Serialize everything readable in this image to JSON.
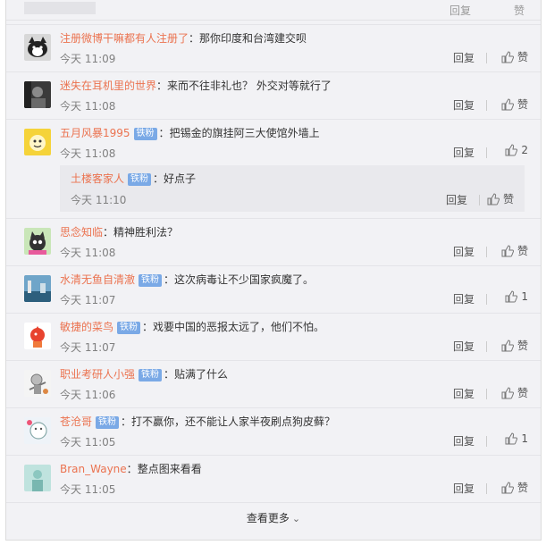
{
  "strip": {
    "reply": "回复",
    "like": "赞"
  },
  "comments": [
    {
      "user": "注册微博干嘛都有人注册了",
      "badge": "铁粉",
      "text": "那你印度和台湾建交呗",
      "time": "今天 11:09",
      "reply": "回复",
      "like": "赞"
    },
    {
      "user": "迷失在耳机里的世界",
      "badge": "",
      "text": "来而不往非礼也？ 外交对等就行了",
      "time": "今天 11:08",
      "reply": "回复",
      "like": "赞"
    },
    {
      "user": "五月风暴1995",
      "badge": "铁粉",
      "text": "把锡金的旗挂阿三大使馆外墙上",
      "time": "今天 11:08",
      "reply": "回复",
      "like": "2",
      "subreply": {
        "user": "土楼客家人",
        "badge": "铁粉",
        "text": "好点子",
        "time": "今天 11:10",
        "reply": "回复",
        "like": "赞"
      }
    },
    {
      "user": "思念知临",
      "badge": "",
      "text": "精神胜利法？",
      "time": "今天 11:08",
      "reply": "回复",
      "like": "赞"
    },
    {
      "user": "水清无鱼自清澈",
      "badge": "铁粉",
      "text": "这次病毒让不少国家疯魔了。",
      "time": "今天 11:07",
      "reply": "回复",
      "like": "1"
    },
    {
      "user": "敏捷的菜鸟",
      "badge": "铁粉",
      "text": "戏要中国的恶报太远了，他们不怕。",
      "time": "今天 11:07",
      "reply": "回复",
      "like": "赞"
    },
    {
      "user": "职业考研人小强",
      "badge": "铁粉",
      "text": "贴满了什么",
      "time": "今天 11:06",
      "reply": "回复",
      "like": "赞"
    },
    {
      "user": "苍沧哥",
      "badge": "铁粉",
      "text": "打不赢你，还不能让人家半夜刷点狗皮藓？",
      "time": "今天 11:05",
      "reply": "回复",
      "like": "1"
    },
    {
      "user": "Bran_Wayne",
      "badge": "",
      "text": "整点图来看看",
      "time": "今天 11:05",
      "reply": "回复",
      "like": "赞"
    }
  ],
  "load_more": "查看更多",
  "colors": {
    "username": "#eb7350",
    "badge": "#7aa9e6",
    "background": "#f2f2f5"
  }
}
